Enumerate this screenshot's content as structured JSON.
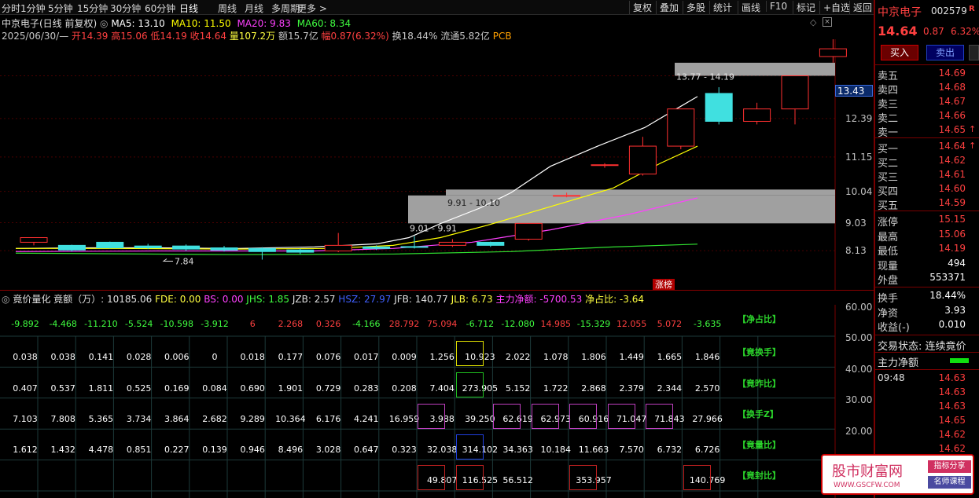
{
  "toolbar": {
    "tabs": [
      "分时",
      "1分钟",
      "5分钟",
      "15分钟",
      "30分钟",
      "60分钟",
      "日线",
      "周线",
      "月线",
      "多周期",
      "更多 >"
    ],
    "active_tab": "日线",
    "buttons": [
      "复权",
      "叠加",
      "多股",
      "统计",
      "画线",
      "F10",
      "标记",
      "+自选",
      "返回"
    ]
  },
  "chart_header": {
    "title": "中京电子(日线 前复权)",
    "ma5": "MA5: 13.10",
    "ma10": "MA10: 11.50",
    "ma20": "MA20: 9.83",
    "ma60": "MA60: 8.34",
    "date": "2025/06/30/—",
    "open": "开14.39",
    "high": "高15.06",
    "low": "低14.19",
    "close": "收14.64",
    "vol": "量107.2万",
    "amount": "额15.7亿",
    "change": "幅0.87(6.32%)",
    "turnover": "换18.44%",
    "float": "流通5.82亿",
    "pcb": "PCB"
  },
  "chart_data": {
    "type": "candlestick",
    "yticks": [
      "13.77",
      "12.39",
      "11.15",
      "10.04",
      "9.03",
      "8.13"
    ],
    "current_price_tag": "13.43",
    "annotations": [
      "15.06",
      "13.77 - 14.19",
      "9.91 - 10.10",
      "9.01 - 9.91",
      "7.84",
      "涨榜"
    ],
    "candles": [
      {
        "o": 8.4,
        "c": 8.55,
        "h": 8.55,
        "l": 8.3
      },
      {
        "o": 8.3,
        "c": 8.15,
        "h": 8.32,
        "l": 8.1
      },
      {
        "o": 8.4,
        "c": 8.22,
        "h": 8.42,
        "l": 8.2
      },
      {
        "o": 8.28,
        "c": 8.22,
        "h": 8.35,
        "l": 8.18
      },
      {
        "o": 8.28,
        "c": 8.18,
        "h": 8.33,
        "l": 8.12
      },
      {
        "o": 8.22,
        "c": 8.15,
        "h": 8.28,
        "l": 8.1
      },
      {
        "o": 8.2,
        "c": 8.1,
        "h": 8.24,
        "l": 7.84
      },
      {
        "o": 8.15,
        "c": 8.08,
        "h": 8.19,
        "l": 8.02
      },
      {
        "o": 8.12,
        "c": 8.3,
        "h": 8.7,
        "l": 8.08
      },
      {
        "o": 8.25,
        "c": 8.2,
        "h": 8.3,
        "l": 8.15
      },
      {
        "o": 8.26,
        "c": 8.24,
        "h": 8.6,
        "l": 8.2
      },
      {
        "o": 8.3,
        "c": 8.4,
        "h": 8.5,
        "l": 8.25
      },
      {
        "o": 8.4,
        "c": 8.3,
        "h": 8.42,
        "l": 8.25
      },
      {
        "o": 8.5,
        "c": 9.01,
        "h": 9.01,
        "l": 8.45
      },
      {
        "o": 9.91,
        "c": 9.91,
        "h": 10.0,
        "l": 9.85
      },
      {
        "o": 10.9,
        "c": 10.9,
        "h": 10.95,
        "l": 10.8
      },
      {
        "o": 10.6,
        "c": 11.5,
        "h": 11.8,
        "l": 10.55
      },
      {
        "o": 11.5,
        "c": 12.7,
        "h": 12.7,
        "l": 11.4
      },
      {
        "o": 13.2,
        "c": 12.3,
        "h": 13.4,
        "l": 12.2
      },
      {
        "o": 12.3,
        "c": 12.7,
        "h": 12.9,
        "l": 12.2
      },
      {
        "o": 12.7,
        "c": 13.77,
        "h": 13.77,
        "l": 12.2
      },
      {
        "o": 14.39,
        "c": 14.64,
        "h": 15.06,
        "l": 14.19
      }
    ],
    "indicator_header": {
      "name": "竟价量化",
      "amount": "竟额（万）: 10185.06",
      "fde": "FDE: 0.00",
      "bs": "BS: 0.00",
      "jhs": "JHS: 1.85",
      "jzb": "JZB: 2.57",
      "hsz": "HSZ: 27.97",
      "jfb": "JFB: 140.77",
      "jlb": "JLB: 6.73",
      "zljb": "主力净额: -5700.53",
      "jzb2": "净占比: -3.64"
    },
    "indicator_axis": [
      "60.00",
      "50.00",
      "40.00",
      "30.00",
      "20.00"
    ],
    "rows": [
      {
        "label": "【净占比】",
        "values": [
          "-9.892",
          "-4.468",
          "-11.210",
          "-5.524",
          "-10.598",
          "-3.912",
          "6",
          "2.268",
          "0.326",
          "-4.166",
          "28.792",
          "75.094",
          "-6.712",
          "-12.080",
          "14.985",
          "-15.329",
          "12.055",
          "5.072",
          "-3.635"
        ]
      },
      {
        "label": "【竟换手】",
        "values": [
          "0.038",
          "0.038",
          "0.141",
          "0.028",
          "0.006",
          "0",
          "0.018",
          "0.177",
          "0.076",
          "0.017",
          "0.009",
          "1.256",
          "10.923",
          "2.022",
          "1.078",
          "1.806",
          "1.449",
          "1.665",
          "1.846"
        ]
      },
      {
        "label": "【竟昨比】",
        "values": [
          "0.407",
          "0.537",
          "1.811",
          "0.525",
          "0.169",
          "0.084",
          "0.690",
          "1.901",
          "0.729",
          "0.283",
          "0.208",
          "7.404",
          "273.905",
          "5.152",
          "1.722",
          "2.868",
          "2.379",
          "2.344",
          "2.570"
        ]
      },
      {
        "label": "【换手Z】",
        "values": [
          "7.103",
          "7.808",
          "5.365",
          "3.734",
          "3.864",
          "2.682",
          "9.289",
          "10.364",
          "6.176",
          "4.241",
          "16.959",
          "3.988",
          "39.250",
          "62.619",
          "62.973",
          "60.916",
          "71.047",
          "71.843",
          "27.966"
        ]
      },
      {
        "label": "【竟量比】",
        "values": [
          "1.612",
          "1.432",
          "4.478",
          "0.851",
          "0.227",
          "0.139",
          "0.946",
          "8.496",
          "3.028",
          "0.647",
          "0.323",
          "32.038",
          "314.102",
          "34.363",
          "10.184",
          "11.663",
          "7.570",
          "6.732",
          "6.726"
        ]
      },
      {
        "label": "【竟封比】",
        "values": [
          "",
          "",
          "",
          "",
          "",
          "",
          "",
          "",
          "",
          "",
          "",
          "49.807",
          "116.525",
          "56.512",
          "",
          "353.957",
          "",
          "",
          "140.769"
        ]
      }
    ]
  },
  "side": {
    "name": "中京电子",
    "code": "002579",
    "price": "14.64",
    "chg": "0.87",
    "pct": "6.32%",
    "buy_btn": "买入",
    "sell_btn": "卖出",
    "asks": [
      [
        "卖五",
        "14.69"
      ],
      [
        "卖四",
        "14.68"
      ],
      [
        "卖三",
        "14.67"
      ],
      [
        "卖二",
        "14.66"
      ],
      [
        "卖一",
        "14.65"
      ]
    ],
    "bids": [
      [
        "买一",
        "14.64"
      ],
      [
        "买二",
        "14.62"
      ],
      [
        "买三",
        "14.61"
      ],
      [
        "买四",
        "14.60"
      ],
      [
        "买五",
        "14.59"
      ]
    ],
    "stats": [
      [
        "涨停",
        "15.15"
      ],
      [
        "最高",
        "15.06"
      ],
      [
        "最低",
        "14.19"
      ],
      [
        "现量",
        "494"
      ],
      [
        "外盘",
        "553371"
      ]
    ],
    "stats2": [
      [
        "换手",
        "18.44%"
      ],
      [
        "净资",
        "3.93"
      ],
      [
        "收益(-)",
        "0.010"
      ]
    ],
    "trade_state": "交易状态: 连续竟价",
    "main_net": "主力净额",
    "tick_time": "09:48",
    "ticks": [
      "14.63",
      "14.63",
      "14.63",
      "14.65",
      "14.62",
      "14.62"
    ]
  },
  "logo": {
    "text": "股市财富网",
    "url": "WWW.GSCFW.COM",
    "tag1": "指标分享",
    "tag2": "名师课程"
  }
}
